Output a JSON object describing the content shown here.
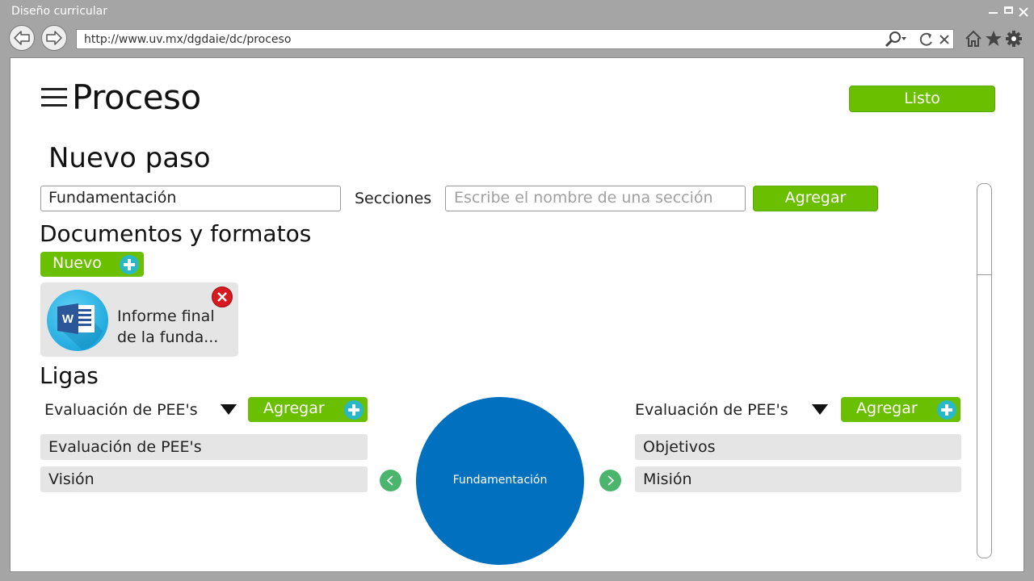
{
  "window": {
    "title": "Diseño curricular",
    "address_url": "http://www.uv.mx/dgdaie/dc/proceso"
  },
  "header": {
    "title": "Proceso",
    "done_label": "Listo"
  },
  "step": {
    "heading": "Nuevo paso",
    "name_value": "Fundamentación",
    "sections_label": "Secciones",
    "section_placeholder": "Escribe el nombre de una sección",
    "add_label": "Agregar"
  },
  "documents": {
    "heading": "Documentos y formatos",
    "new_label": "Nuevo",
    "items": [
      {
        "name": "Informe final de la funda...",
        "icon": "word-icon"
      }
    ]
  },
  "links": {
    "heading": "Ligas",
    "left": {
      "selected": "Evaluación de PEE's",
      "add_label": "Agregar",
      "items": [
        "Evaluación de PEE's",
        "Visión"
      ]
    },
    "center_node": "Fundamentación",
    "right": {
      "selected": "Evaluación de PEE's",
      "add_label": "Agregar",
      "items": [
        "Objetivos",
        "Misión"
      ]
    }
  },
  "colors": {
    "accent_green": "#6abf00",
    "node_blue": "#0070bf",
    "plus_teal": "#29b9c6",
    "arrow_green": "#4cb56d",
    "remove_red": "#d71920"
  }
}
